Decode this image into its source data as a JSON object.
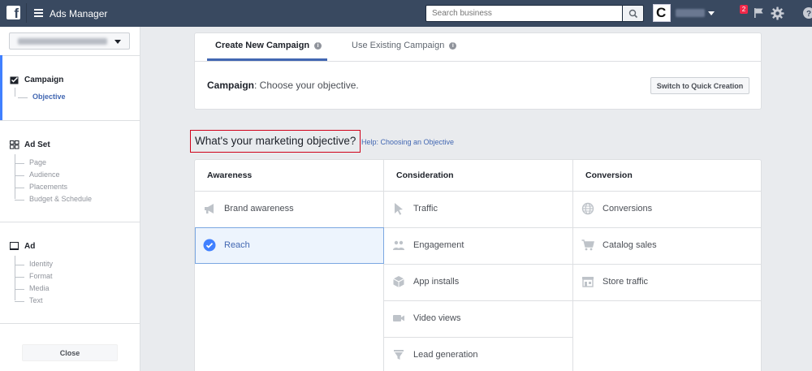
{
  "topbar": {
    "title": "Ads Manager",
    "search_placeholder": "Search business",
    "notification_count": "2"
  },
  "sidebar": {
    "sections": [
      {
        "label": "Campaign",
        "items": [
          "Objective"
        ]
      },
      {
        "label": "Ad Set",
        "items": [
          "Page",
          "Audience",
          "Placements",
          "Budget & Schedule"
        ]
      },
      {
        "label": "Ad",
        "items": [
          "Identity",
          "Format",
          "Media",
          "Text"
        ]
      }
    ],
    "close_label": "Close"
  },
  "tabs": [
    {
      "label": "Create New Campaign",
      "active": true
    },
    {
      "label": "Use Existing Campaign",
      "active": false
    }
  ],
  "campaign": {
    "label": "Campaign",
    "text": ": Choose your objective.",
    "quick_button": "Switch to Quick Creation"
  },
  "objective": {
    "title": "What's your marketing objective?",
    "help_link": "Help: Choosing an Objective"
  },
  "columns": [
    {
      "header": "Awareness",
      "options": [
        {
          "label": "Brand awareness",
          "icon": "megaphone-icon"
        },
        {
          "label": "Reach",
          "icon": "checkmark-icon",
          "selected": true
        }
      ]
    },
    {
      "header": "Consideration",
      "options": [
        {
          "label": "Traffic",
          "icon": "cursor-icon"
        },
        {
          "label": "Engagement",
          "icon": "people-icon"
        },
        {
          "label": "App installs",
          "icon": "box-icon"
        },
        {
          "label": "Video views",
          "icon": "video-camera-icon"
        },
        {
          "label": "Lead generation",
          "icon": "funnel-icon"
        }
      ]
    },
    {
      "header": "Conversion",
      "options": [
        {
          "label": "Conversions",
          "icon": "globe-icon"
        },
        {
          "label": "Catalog sales",
          "icon": "cart-icon"
        },
        {
          "label": "Store traffic",
          "icon": "store-icon"
        }
      ]
    }
  ],
  "colors": {
    "accent": "#4267b2",
    "topbar": "#394960",
    "highlight": "#d0021b",
    "selected_bg": "#edf4fd"
  }
}
